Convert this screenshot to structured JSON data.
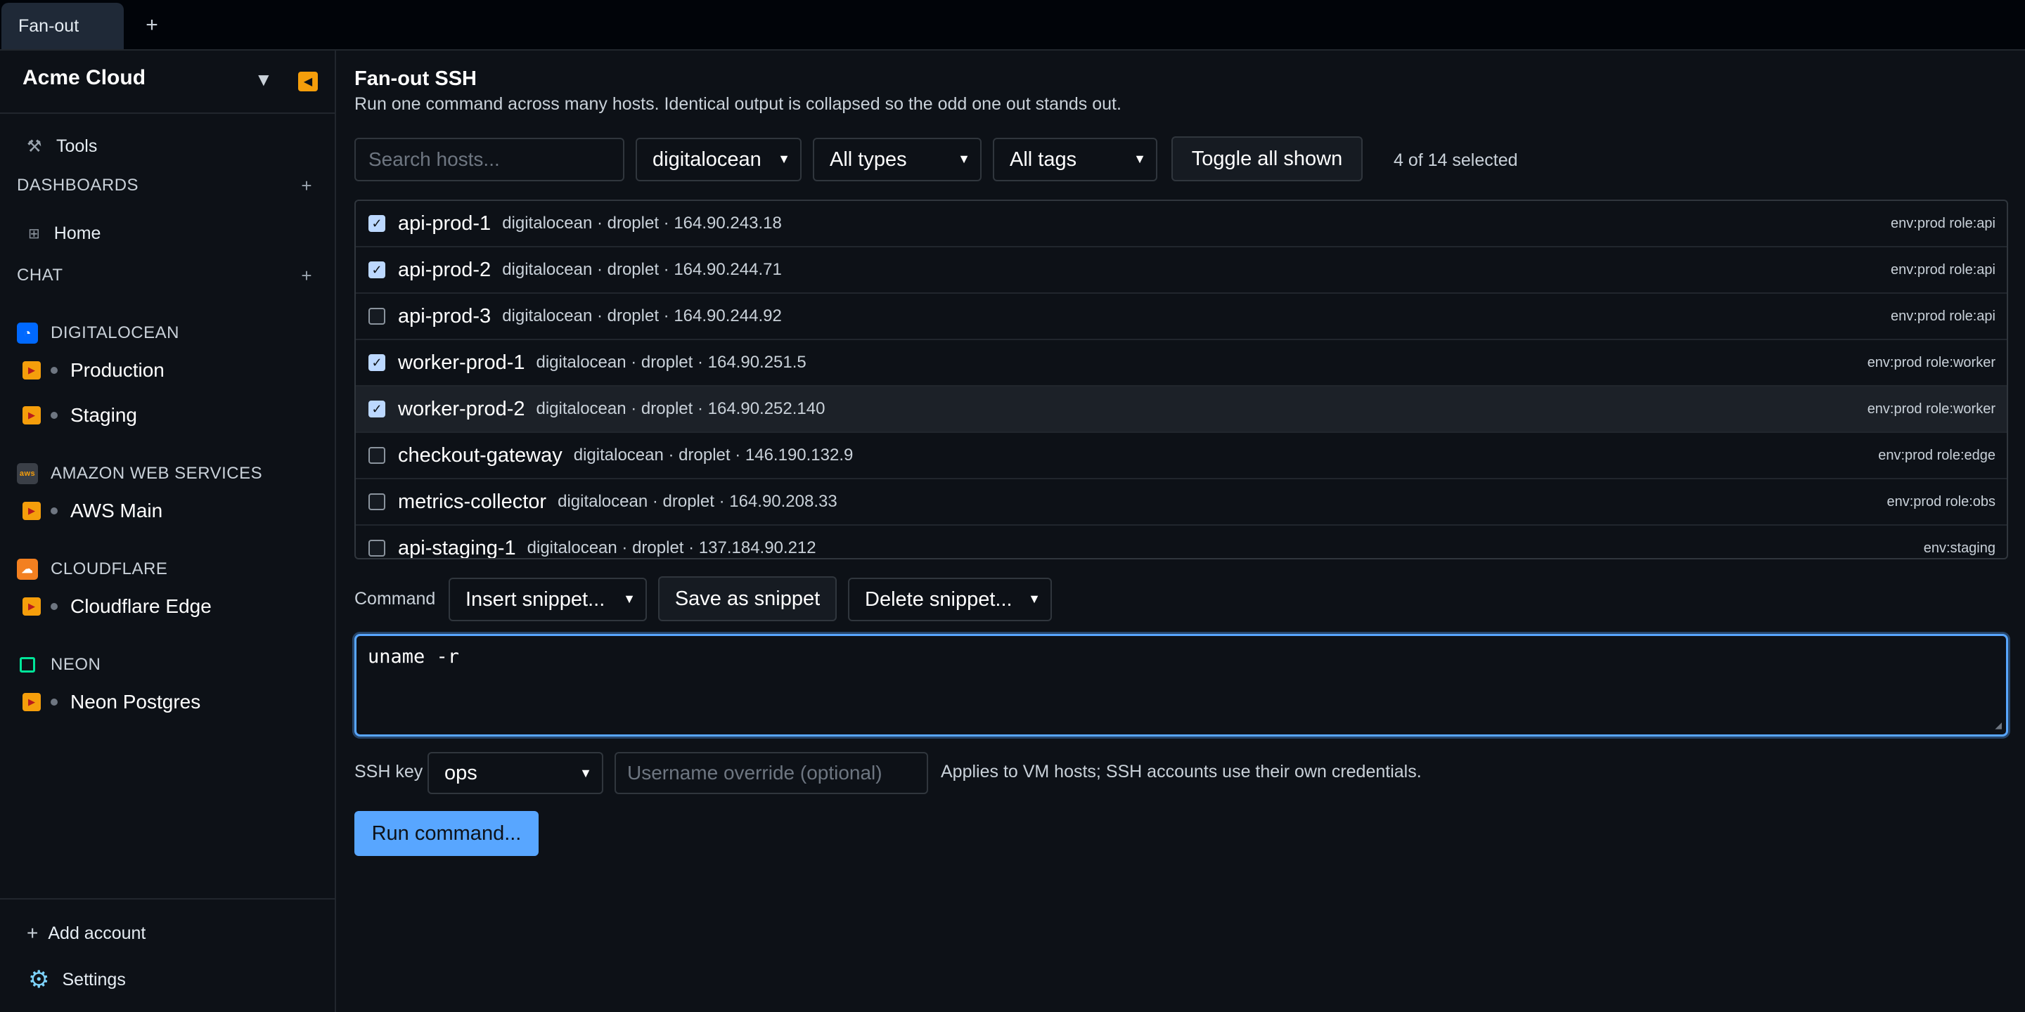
{
  "tabs": {
    "active_label": "Fan-out",
    "add_label": "+"
  },
  "sidebar": {
    "org_name": "Acme Cloud",
    "caret": "▼",
    "tools_label": "Tools",
    "dashboards_heading": "DASHBOARDS",
    "dashboards_add": "+",
    "home_label": "Home",
    "chat_heading": "CHAT",
    "chat_add": "+",
    "providers": [
      {
        "name": "DIGITALOCEAN",
        "icon": "digitalocean-logo-icon",
        "accounts": [
          "Production",
          "Staging"
        ]
      },
      {
        "name": "AMAZON WEB SERVICES",
        "icon": "aws-logo-icon",
        "accounts": [
          "AWS Main"
        ]
      },
      {
        "name": "CLOUDFLARE",
        "icon": "cloudflare-logo-icon",
        "accounts": [
          "Cloudflare Edge"
        ]
      },
      {
        "name": "NEON",
        "icon": "neon-logo-icon",
        "accounts": [
          "Neon Postgres"
        ]
      }
    ],
    "add_account_label": "Add account",
    "settings_label": "Settings"
  },
  "main": {
    "title": "Fan-out SSH",
    "subtitle": "Run one command across many hosts. Identical output is collapsed so the odd one out stands out.",
    "filters": {
      "search_placeholder": "Search hosts...",
      "provider_value": "digitalocean",
      "type_value": "All types",
      "tags_value": "All tags",
      "toggle_label": "Toggle all shown",
      "selection_count": "4 of 14 selected"
    },
    "hosts": [
      {
        "name": "api-prod-1",
        "meta": "digitalocean · droplet · 164.90.243.18",
        "tags": "env:prod role:api",
        "checked": true
      },
      {
        "name": "api-prod-2",
        "meta": "digitalocean · droplet · 164.90.244.71",
        "tags": "env:prod role:api",
        "checked": true
      },
      {
        "name": "api-prod-3",
        "meta": "digitalocean · droplet · 164.90.244.92",
        "tags": "env:prod role:api",
        "checked": false
      },
      {
        "name": "worker-prod-1",
        "meta": "digitalocean · droplet · 164.90.251.5",
        "tags": "env:prod role:worker",
        "checked": true
      },
      {
        "name": "worker-prod-2",
        "meta": "digitalocean · droplet · 164.90.252.140",
        "tags": "env:prod role:worker",
        "checked": true
      },
      {
        "name": "checkout-gateway",
        "meta": "digitalocean · droplet · 146.190.132.9",
        "tags": "env:prod role:edge",
        "checked": false
      },
      {
        "name": "metrics-collector",
        "meta": "digitalocean · droplet · 164.90.208.33",
        "tags": "env:prod role:obs",
        "checked": false
      },
      {
        "name": "api-staging-1",
        "meta": "digitalocean · droplet · 137.184.90.212",
        "tags": "env:staging",
        "checked": false
      }
    ],
    "command": {
      "label": "Command",
      "insert_snippet": "Insert snippet...",
      "save_snippet": "Save as snippet",
      "delete_snippet": "Delete snippet...",
      "value": "uname -r"
    },
    "ssh": {
      "label": "SSH key",
      "key_value": "ops",
      "username_placeholder": "Username override (optional)",
      "hint": "Applies to VM hosts; SSH accounts use their own credentials."
    },
    "run_label": "Run command..."
  },
  "colors": {
    "accent": "#58a6ff",
    "account_icon": "#f59e0b",
    "background": "#0d1117"
  }
}
